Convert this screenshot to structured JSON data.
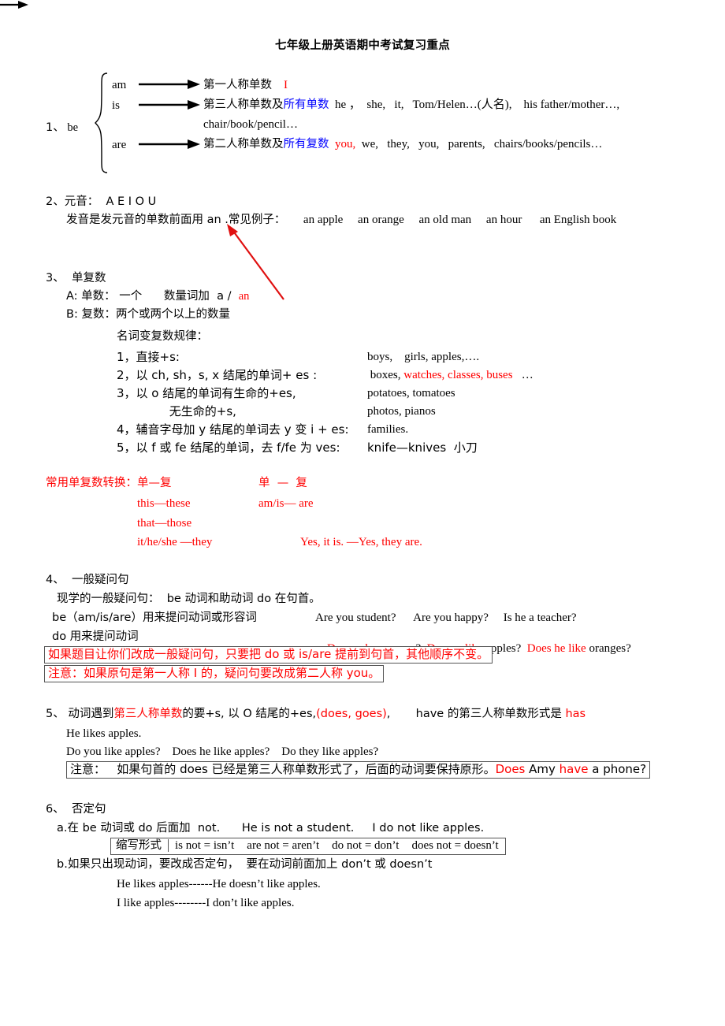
{
  "document": {
    "title": "七年级上册英语期中考试复习重点",
    "colors": {
      "red": "#ff0000",
      "blue": "#0000ff",
      "black": "#000000",
      "box_border": "#555555"
    }
  },
  "section1": {
    "number": "1、",
    "topic": "be",
    "rows": [
      {
        "verb": "am",
        "desc": "第一人称单数",
        "highlight": "",
        "example_red": "I",
        "examples": ""
      },
      {
        "verb": "is",
        "desc": "第三人称单数及",
        "highlight": "所有单数",
        "example_red": "",
        "examples": "he ，  she,   it,   Tom/Helen…(人名),    his father/mother…,"
      },
      {
        "verb": "",
        "desc": "",
        "highlight": "",
        "example_red": "",
        "examples": "chair/book/pencil…"
      },
      {
        "verb": "are",
        "desc": "第二人称单数及",
        "highlight": "所有复数",
        "example_red": "you,",
        "examples": "  we,   they,   you,   parents,   chairs/books/pencils…"
      }
    ]
  },
  "section2": {
    "number": "2、",
    "heading": "元音：  A E I O U",
    "rule": "发音是发元音的单数前面用 an .常见例子：",
    "examples": "an apple     an orange     an old man     an hour      an English book"
  },
  "section3": {
    "number": "3、",
    "heading": "单复数",
    "line_a_prefix": "A: 单数： 一个      数量词加  a /  ",
    "line_a_red": "an",
    "line_b": "B: 复数：两个或两个以上的数量",
    "rules_heading": "名词变复数规律：",
    "rules": [
      {
        "text": "1，直接+s:",
        "example_black": "boys,    girls, apples,….",
        "example_red": "",
        "example_tail": ""
      },
      {
        "text": "2，以 ch, sh，s, x 结尾的单词+ es :",
        "example_black": " boxes,",
        "example_red": " watches, classes, buses",
        "example_tail": "   …"
      },
      {
        "text": "3，以 o 结尾的单词有生命的+es,",
        "example_black": "potatoes, tomatoes",
        "example_red": "",
        "example_tail": ""
      },
      {
        "text": "              无生命的+s,",
        "example_black": "photos, pianos",
        "example_red": "",
        "example_tail": ""
      },
      {
        "text": "4，辅音字母加 y 结尾的单词去 y 变 i + es:",
        "example_black": "families.",
        "example_red": "",
        "example_tail": ""
      },
      {
        "text": "5，以 f 或 fe 结尾的单词，去 f/fe 为 ves:",
        "example_black": "knife—knives  小刀",
        "example_red": "",
        "example_tail": ""
      }
    ],
    "conversion": {
      "heading_left": "常用单复数转换：单—复",
      "heading_right": "单  —  复",
      "pairs_left": [
        "this—these",
        "that—those",
        "it/he/she —they"
      ],
      "pairs_right": [
        "am/is— are"
      ],
      "answer": "Yes, it is. —Yes, they are."
    }
  },
  "section4": {
    "number": "4、",
    "heading": "一般疑问句",
    "line1": "现学的一般疑问句：  be 动词和助动词 do 在句首。",
    "line2_label": "be（am/is/are）用来提问动词或形容词",
    "line2_examples": "Are you student?      Are you happy?     Is he a teacher?",
    "line3_label": "do 用来提问动词",
    "line3_examples": [
      {
        "red": "Do",
        "black": " you ",
        "red2": "have",
        "black2": " a pen?"
      },
      {
        "red": "Do",
        "black": " you ",
        "red2": "like",
        "black2": " apples?"
      },
      {
        "red": "Does he like",
        "black": "",
        "red2": "",
        "black2": " oranges?"
      }
    ],
    "box1": "如果题目让你们改成一般疑问句，只要把 do 或 is/are 提前到句首，其他顺序不变。",
    "box2": "注意：如果原句是第一人称 I 的，疑问句要改成第二人称 you。"
  },
  "section5": {
    "number": "5、",
    "line1_a": "动词遇到",
    "line1_red1": "第三人称单数",
    "line1_b": "的要+s, 以 O 结尾的+es,",
    "line1_red2": "(does, goes)",
    "line1_c": ",       have 的第三人称单数形式是 ",
    "line1_red3": "has",
    "line2": "He likes apples.",
    "line3": "Do you like apples?    Does he like apples?    Do they like apples?",
    "box_black": "注意：   如果句首的 does 已经是第三人称单数形式了，后面的动词要保持原形。",
    "box_red1": "Does",
    "box_black2": " Amy ",
    "box_red2": "have",
    "box_black3": " a phone?"
  },
  "section6": {
    "number": "6、",
    "heading": "否定句",
    "line_a": "a.在 be 动词或 do 后面加  not.      He is not a student.     I do not like apples.",
    "contractions_label": "缩写形式",
    "contractions": [
      "is not = isn’t",
      "are not = aren’t",
      "do not = don’t",
      "does not = doesn’t"
    ],
    "line_b": "b.如果只出现动词，要改成否定句，  要在动词前面加上 don’t 或 doesn’t",
    "examples": [
      "He likes apples------He doesn’t like apples.",
      "I like apples--------I don’t like apples."
    ]
  }
}
